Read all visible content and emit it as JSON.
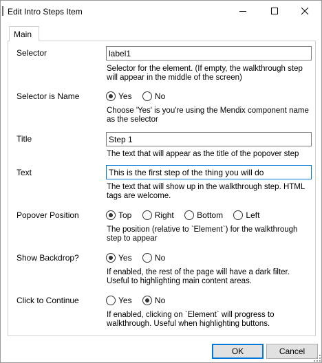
{
  "window": {
    "title": "Edit Intro Steps Item"
  },
  "tab": {
    "label": "Main"
  },
  "selector": {
    "label": "Selector",
    "value": "label1",
    "description": "Selector for the element. (If empty, the walkthrough step will appear in the middle of the screen)"
  },
  "selector_is_name": {
    "label": "Selector is Name",
    "options": [
      "Yes",
      "No"
    ],
    "selected": "Yes",
    "description": "Choose 'Yes' is you're using the Mendix component name as the selector"
  },
  "title": {
    "label": "Title",
    "value": "Step 1",
    "description": "The text that will appear as the title of the popover step"
  },
  "text": {
    "label": "Text",
    "value": "This is the first step of the thing you will do",
    "description": "The text that will show up in the walkthrough step. HTML tags are welcome."
  },
  "popover_position": {
    "label": "Popover Position",
    "options": [
      "Top",
      "Right",
      "Bottom",
      "Left"
    ],
    "selected": "Top",
    "description": "The position (relative to `Element`) for the walkthrough step to appear"
  },
  "show_backdrop": {
    "label": "Show Backdrop?",
    "options": [
      "Yes",
      "No"
    ],
    "selected": "Yes",
    "description": "If enabled, the rest of the page will have a dark filter. Useful to highlighting main content areas."
  },
  "click_to_continue": {
    "label": "Click to Continue",
    "options": [
      "Yes",
      "No"
    ],
    "selected": "No",
    "description": "If enabled, clicking on `Element` will progress to walkthrough. Useful when highlighting buttons."
  },
  "buttons": {
    "ok": "OK",
    "cancel": "Cancel"
  },
  "icons": {
    "minimize": "minimize-icon",
    "maximize": "maximize-icon",
    "close": "close-icon",
    "resize": "resize-grip-icon"
  },
  "colors": {
    "accent": "#0078d7",
    "button_face": "#e1e1e1",
    "border": "#7a7a7a"
  }
}
